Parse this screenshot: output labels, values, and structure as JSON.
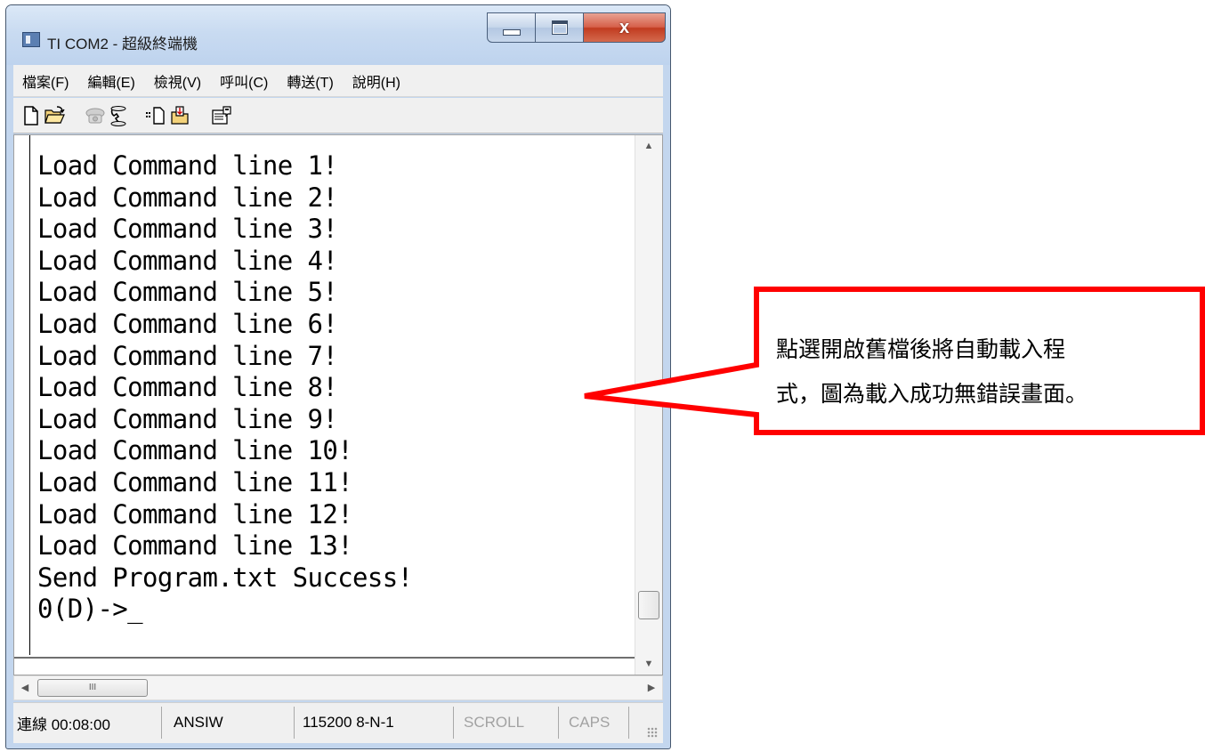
{
  "window": {
    "title": "TI COM2 - 超級終端機",
    "close_glyph": "x"
  },
  "menu": [
    "檔案(F)",
    "編輯(E)",
    "檢視(V)",
    "呼叫(C)",
    "轉送(T)",
    "說明(H)"
  ],
  "toolbar": {
    "icons": [
      "new-file-icon",
      "open-folder-icon",
      "phone-call-icon",
      "phone-disconnect-icon",
      "send-file-icon",
      "receive-file-icon",
      "properties-icon"
    ]
  },
  "terminal": {
    "lines": [
      "Load Command line 1!",
      "Load Command line 2!",
      "Load Command line 3!",
      "Load Command line 4!",
      "Load Command line 5!",
      "Load Command line 6!",
      "Load Command line 7!",
      "Load Command line 8!",
      "Load Command line 9!",
      "Load Command line 10!",
      "Load Command line 11!",
      "Load Command line 12!",
      "Load Command line 13!",
      "Send Program.txt Success!",
      "0(D)->_"
    ]
  },
  "scrollbar": {
    "up_glyph": "▲",
    "down_glyph": "▼",
    "left_glyph": "◀",
    "right_glyph": "▶",
    "hthumb_grip": "III"
  },
  "status": {
    "connection": "連線 00:08:00",
    "emulation": "ANSIW",
    "port_settings": "115200 8-N-1",
    "scroll": "SCROLL",
    "caps": "CAPS"
  },
  "callout": {
    "line1": "點選開啟舊檔後將自動載入程",
    "line2": "式，圖為載入成功無錯誤畫面。",
    "border_color": "#ff0000"
  }
}
